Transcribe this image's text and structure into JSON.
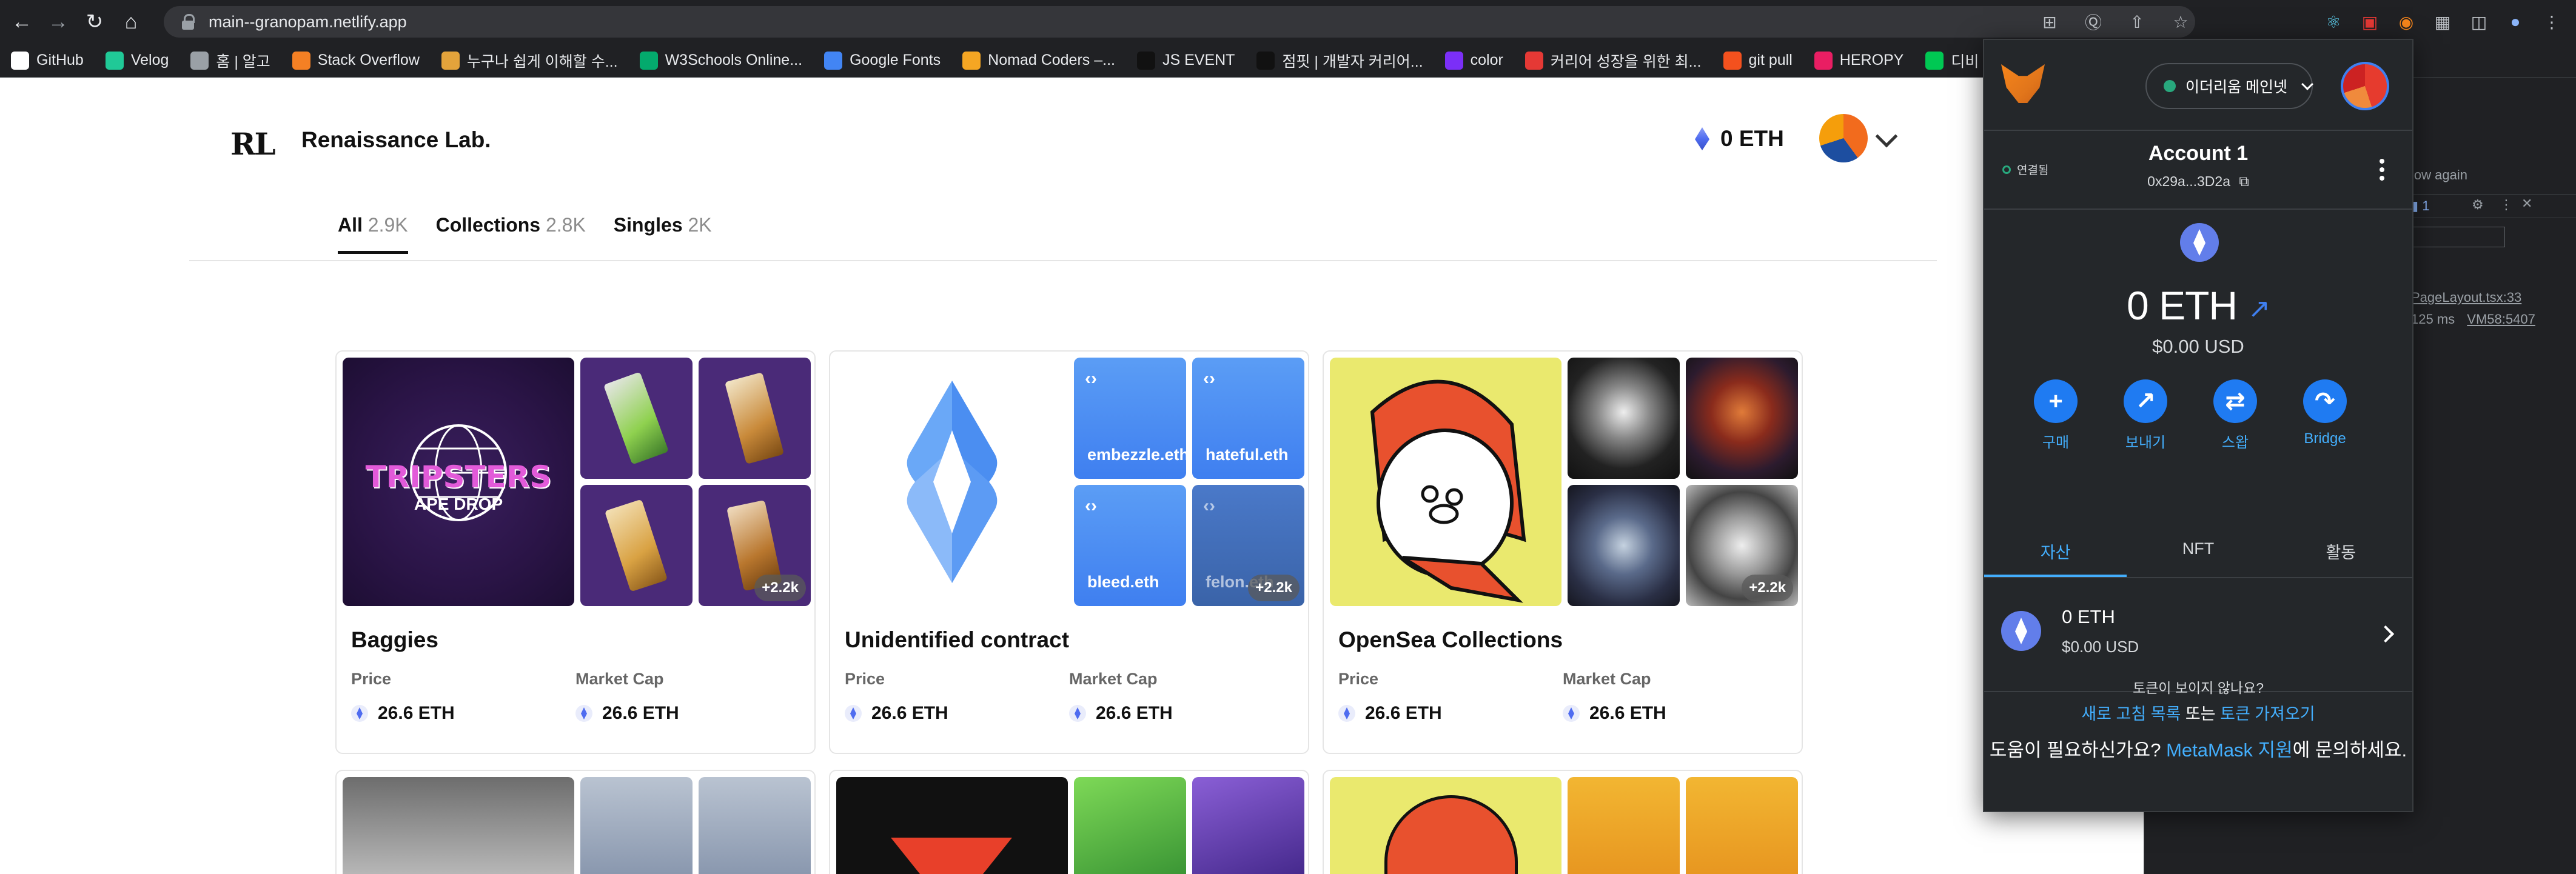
{
  "browser": {
    "url": "main--granopam.netlify.app",
    "bookmarks": [
      {
        "label": "GitHub",
        "color": "#ffffff"
      },
      {
        "label": "Velog",
        "color": "#20c997"
      },
      {
        "label": "홈 | 알고",
        "color": "#9aa0a6"
      },
      {
        "label": "Stack Overflow",
        "color": "#f48024"
      },
      {
        "label": "누구나 쉽게 이해할 수...",
        "color": "#e3a33b"
      },
      {
        "label": "W3Schools Online...",
        "color": "#04aa6d"
      },
      {
        "label": "Google Fonts",
        "color": "#4285f4"
      },
      {
        "label": "Nomad Coders –...",
        "color": "#f5a623"
      },
      {
        "label": "JS EVENT",
        "color": "#111111"
      },
      {
        "label": "점핏 | 개발자 커리어...",
        "color": "#111111"
      },
      {
        "label": "color",
        "color": "#7b2ff7"
      },
      {
        "label": "커리어 성장을 위한 최...",
        "color": "#e53935"
      },
      {
        "label": "git pull",
        "color": "#f4511e"
      },
      {
        "label": "HEROPY",
        "color": "#e91e63"
      },
      {
        "label": "디비",
        "color": "#00c853"
      }
    ]
  },
  "site": {
    "logo_mark": "RL",
    "brand": "Renaissance Lab.",
    "wallet_balance": "0 ETH",
    "tabs": [
      {
        "label": "All",
        "count": "2.9K"
      },
      {
        "label": "Collections",
        "count": "2.8K"
      },
      {
        "label": "Singles",
        "count": "2K"
      }
    ],
    "cards": [
      {
        "name": "Baggies",
        "big_text": "TRIPSTERS",
        "big_sub": "APE DROP",
        "more": "+2.2k",
        "price_label": "Price",
        "price": "26.6 ETH",
        "cap_label": "Market Cap",
        "cap": "26.6 ETH"
      },
      {
        "name": "Unidentified contract",
        "more": "+2.2k",
        "ens": [
          "embezzle.eth",
          "hateful.eth",
          "bleed.eth",
          "felon.eth"
        ],
        "price_label": "Price",
        "price": "26.6 ETH",
        "cap_label": "Market Cap",
        "cap": "26.6 ETH"
      },
      {
        "name": "OpenSea Collections",
        "more": "+2.2k",
        "price_label": "Price",
        "price": "26.6 ETH",
        "cap_label": "Market Cap",
        "cap": "26.6 ETH"
      }
    ]
  },
  "devtools": {
    "line1": "low again",
    "issues": "1",
    "file_link": "PageLayout.tsx:33",
    "timing": "125 ms",
    "vm_link": "VM58:5407"
  },
  "metamask": {
    "network": "이더리움 메인넷",
    "connected": "연결됨",
    "account_name": "Account 1",
    "address": "0x29a...3D2a",
    "balance": "0 ETH",
    "usd": "$0.00 USD",
    "actions": [
      {
        "label": "구매",
        "icon": "plus-icon"
      },
      {
        "label": "보내기",
        "icon": "send-arrow-icon"
      },
      {
        "label": "스왑",
        "icon": "swap-arrows-icon"
      },
      {
        "label": "Bridge",
        "icon": "bridge-icon"
      }
    ],
    "tabs": [
      "자산",
      "NFT",
      "활동"
    ],
    "asset": {
      "amount": "0 ETH",
      "usd": "$0.00 USD"
    },
    "missing_question": "토큰이 보이지 않나요?",
    "refresh_link": "새로 고침 목록",
    "or_text": "또는",
    "import_link": "토큰 가져오기",
    "help_prefix": "도움이 필요하신가요?",
    "help_link": "MetaMask 지원",
    "help_suffix": "에 문의하세요."
  }
}
